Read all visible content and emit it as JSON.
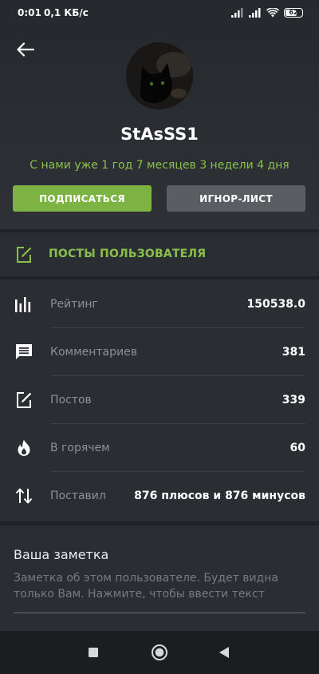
{
  "status_bar": {
    "time": "0:01",
    "network_speed": "0,1 КБ/с",
    "battery": "62",
    "icons": [
      "signal-icon",
      "signal-icon",
      "wifi-icon",
      "battery-icon"
    ]
  },
  "profile": {
    "username": "StAsSS1",
    "member_since": "С нами уже 1 год 7 месяцев 3 недели 4 дня",
    "subscribe_label": "ПОДПИСАТЬСЯ",
    "ignore_label": "ИГНОР-ЛИСТ"
  },
  "posts_link": {
    "label": "ПОСТЫ ПОЛЬЗОВАТЕЛЯ",
    "icon": "edit-icon"
  },
  "stats": [
    {
      "icon": "bar-chart-icon",
      "label": "Рейтинг",
      "value": "150538.0"
    },
    {
      "icon": "comment-icon",
      "label": "Комментариев",
      "value": "381"
    },
    {
      "icon": "edit-icon",
      "label": "Постов",
      "value": "339"
    },
    {
      "icon": "fire-icon",
      "label": "В горячем",
      "value": "60"
    },
    {
      "icon": "sort-arrows-icon",
      "label": "Поставил",
      "value": "876 плюсов и 876 минусов"
    }
  ],
  "note": {
    "title": "Ваша заметка",
    "placeholder": "Заметка об этом пользователе. Будет видна только Вам. Нажмите, чтобы ввести текст"
  },
  "colors": {
    "accent": "#7cb342",
    "accent_text": "#8ac04a",
    "ignore_button": "#5a5d61",
    "background": "#1f2327",
    "panel": "#2a2e33"
  }
}
